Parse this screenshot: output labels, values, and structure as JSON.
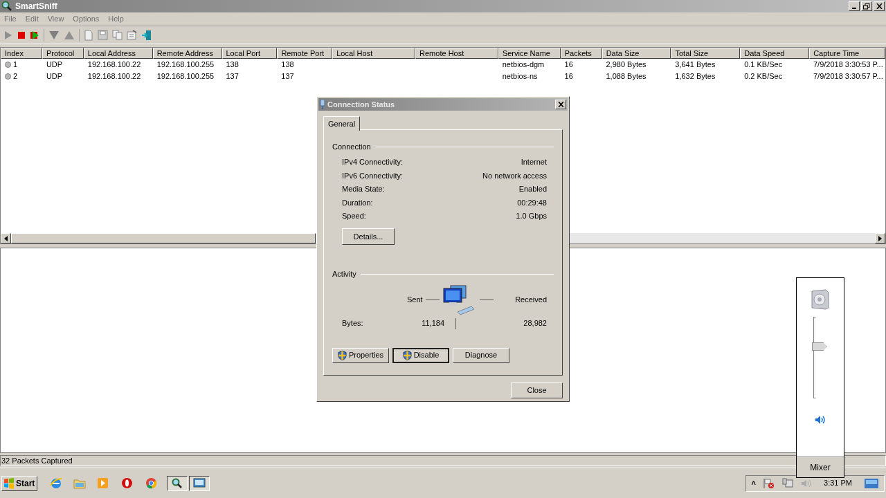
{
  "window": {
    "title": "SmartSniff"
  },
  "menu": [
    "File",
    "Edit",
    "View",
    "Options",
    "Help"
  ],
  "table": {
    "columns": [
      {
        "label": "Index"
      },
      {
        "label": "Protocol"
      },
      {
        "label": "Local Address"
      },
      {
        "label": "Remote Address"
      },
      {
        "label": "Local Port"
      },
      {
        "label": "Remote Port"
      },
      {
        "label": "Local Host"
      },
      {
        "label": "Remote Host"
      },
      {
        "label": "Service Name"
      },
      {
        "label": "Packets"
      },
      {
        "label": "Data Size"
      },
      {
        "label": "Total Size"
      },
      {
        "label": "Data Speed"
      },
      {
        "label": "Capture Time"
      }
    ],
    "rows": [
      {
        "cells": [
          "1",
          "UDP",
          "192.168.100.22",
          "192.168.100.255",
          "138",
          "138",
          null,
          null,
          "netbios-dgm",
          "16",
          "2,980 Bytes",
          "3,641 Bytes",
          "0.1 KB/Sec",
          "7/9/2018 3:30:53 P..."
        ]
      },
      {
        "cells": [
          "2",
          "UDP",
          "192.168.100.22",
          "192.168.100.255",
          "137",
          "137",
          null,
          null,
          "netbios-ns",
          "16",
          "1,088 Bytes",
          "1,632 Bytes",
          "0.2 KB/Sec",
          "7/9/2018 3:30:57 P..."
        ]
      }
    ]
  },
  "status_bar": "32 Packets Captured",
  "dialog": {
    "title": "Connection Status",
    "tabs": [
      {
        "label": "General",
        "selected": true
      }
    ],
    "connection_heading": "Connection",
    "fields": [
      {
        "label": "IPv4 Connectivity:",
        "value": "Internet"
      },
      {
        "label": "IPv6 Connectivity:",
        "value": "No network access"
      },
      {
        "label": "Media State:",
        "value": "Enabled"
      },
      {
        "label": "Duration:",
        "value": "00:29:48"
      },
      {
        "label": "Speed:",
        "value": "1.0 Gbps"
      }
    ],
    "details_button": "Details...",
    "activity_heading": "Activity",
    "sent_label": "Sent",
    "received_label": "Received",
    "bytes_label": "Bytes:",
    "sent_bytes": "11,184",
    "received_bytes": "28,982",
    "buttons": [
      {
        "label": "Properties",
        "shield": true,
        "focused": false
      },
      {
        "label": "Disable",
        "shield": true,
        "focused": true
      },
      {
        "label": "Diagnose",
        "shield": false,
        "focused": false
      }
    ],
    "close_button": "Close"
  },
  "volume": {
    "level": 0.65,
    "mixer": "Mixer"
  },
  "taskbar": {
    "start": "Start",
    "tray_expand": "˄",
    "clock": "3:31 PM"
  }
}
